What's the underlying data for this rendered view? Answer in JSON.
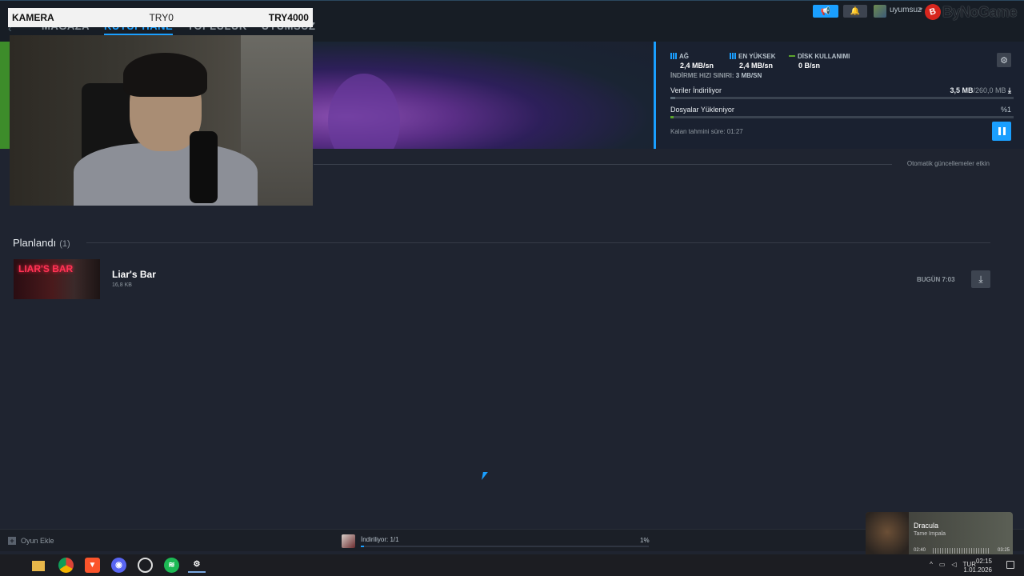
{
  "nav": {
    "items": [
      {
        "label": "MAĞAZA",
        "active": false
      },
      {
        "label": "KÜTÜPHANE",
        "active": true
      },
      {
        "label": "TOPLULUK",
        "active": false
      },
      {
        "label": "UYUMSUZ",
        "active": false
      }
    ]
  },
  "account": {
    "username": "uyumsuz"
  },
  "brand": {
    "mark": "B",
    "text": "ByNoGame"
  },
  "camera": {
    "label": "KAMERA",
    "mid": "TRY0",
    "right": "TRY4000"
  },
  "download": {
    "network": {
      "label": "AĞ",
      "value": "2,4 MB/sn"
    },
    "peak": {
      "label": "EN YÜKSEK",
      "value": "2,4 MB/sn"
    },
    "disk": {
      "label": "DİSK KULLANIMI",
      "value": "0 B/sn"
    },
    "limit_label": "İNDİRME HIZI SINIRI:",
    "limit_value": "3 MB/sn",
    "row1_label": "Veriler İndiriliyor",
    "row1_done": "3,5 MB",
    "row1_total": "/260,0 MB",
    "row1_fraction": 0.013,
    "row2_label": "Dosyalar Yükleniyor",
    "row2_value": "%1",
    "row2_fraction": 0.01,
    "eta_label": "Kalan tahmini süre:",
    "eta_value": "01:27"
  },
  "auto_update": "Otomatik güncellemeler etkin",
  "scheduled": {
    "title": "Planlandı",
    "count": "(1)",
    "game": {
      "name": "Liar's Bar",
      "size": "16,8 KB",
      "thumb_text": "LIAR'S BAR",
      "time": "BUGÜN 7:03"
    }
  },
  "statusbar": {
    "add_game": "Oyun Ekle",
    "downloading": "İndiriliyor: 1/1",
    "percent": "1%",
    "fraction": 0.01
  },
  "media": {
    "title": "Dracula",
    "artist": "Tame Impala",
    "elapsed": "02:40",
    "duration": "03:25",
    "fraction": 0.78
  },
  "taskbar": {
    "lang": "TUR",
    "time": "02:15",
    "date": "1.01.2026"
  },
  "colors": {
    "accent": "#1a9fff",
    "green": "#5ba32b",
    "brand": "#d7261e"
  }
}
